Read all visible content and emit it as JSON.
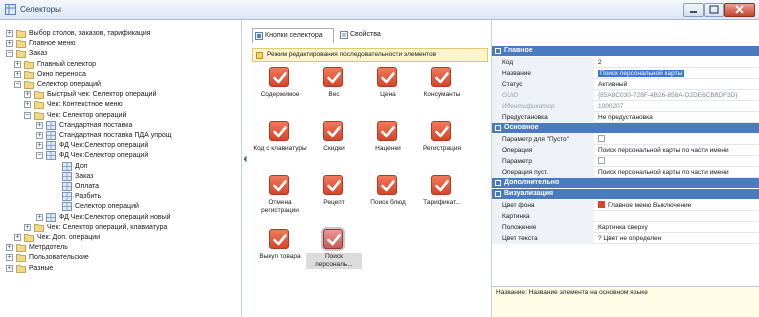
{
  "window": {
    "title": "Селекторы"
  },
  "tree": [
    {
      "label": "Выбор столов, заказов, тарификация",
      "level": 0,
      "exp": "+",
      "icon": "folder"
    },
    {
      "label": "Главное меню",
      "level": 0,
      "exp": "+",
      "icon": "folder"
    },
    {
      "label": "Заказ",
      "level": 0,
      "exp": "−",
      "icon": "folder"
    },
    {
      "label": "Главный селектор",
      "level": 1,
      "exp": "+",
      "icon": "folder"
    },
    {
      "label": "Окно переноса",
      "level": 1,
      "exp": "+",
      "icon": "folder"
    },
    {
      "label": "Селектор операций",
      "level": 1,
      "exp": "−",
      "icon": "folder"
    },
    {
      "label": "Быстрый чек: Селектор операций",
      "level": 2,
      "exp": "+",
      "icon": "folder"
    },
    {
      "label": "Чек: Контекстное меню",
      "level": 2,
      "exp": "+",
      "icon": "folder"
    },
    {
      "label": "Чек: Селектор операций",
      "level": 2,
      "exp": "−",
      "icon": "folder"
    },
    {
      "label": "Стандартная поставка",
      "level": 3,
      "exp": "+",
      "icon": "grid"
    },
    {
      "label": "Стандартная поставка ПДА упрощ",
      "level": 3,
      "exp": "+",
      "icon": "grid"
    },
    {
      "label": "ФД Чек:Селектор операций",
      "level": 3,
      "exp": "+",
      "icon": "grid"
    },
    {
      "label": "ФД Чек:Селектор операций",
      "level": 3,
      "exp": "−",
      "icon": "grid"
    },
    {
      "label": "Доп",
      "level": 4,
      "exp": "",
      "icon": "grid"
    },
    {
      "label": "Заказ",
      "level": 4,
      "exp": "",
      "icon": "grid"
    },
    {
      "label": "Оплата",
      "level": 4,
      "exp": "",
      "icon": "grid"
    },
    {
      "label": "Разбить",
      "level": 4,
      "exp": "",
      "icon": "grid"
    },
    {
      "label": "Селектор операций",
      "level": 4,
      "exp": "",
      "icon": "grid"
    },
    {
      "label": "ФД Чек:Селектор операций новый",
      "level": 3,
      "exp": "+",
      "icon": "grid"
    },
    {
      "label": "Чек: Селектор операций, клавиатура",
      "level": 2,
      "exp": "+",
      "icon": "folder"
    },
    {
      "label": "Чек: Доп. операции",
      "level": 1,
      "exp": "+",
      "icon": "folder"
    },
    {
      "label": "Метрдотель",
      "level": 0,
      "exp": "+",
      "icon": "folder"
    },
    {
      "label": "Пользовательские",
      "level": 0,
      "exp": "+",
      "icon": "folder"
    },
    {
      "label": "Разные",
      "level": 0,
      "exp": "+",
      "icon": "folder"
    }
  ],
  "middle": {
    "tabs": [
      {
        "label": "Кнопки селектора",
        "icon": "buttons-tab-icon"
      },
      {
        "label": "Свойства",
        "icon": "properties-tab-icon"
      }
    ],
    "banner": "Режим редактирования последовательности элементов",
    "items": [
      {
        "label": "Содержимое",
        "selected": false
      },
      {
        "label": "Вес",
        "selected": false
      },
      {
        "label": "Цена",
        "selected": false
      },
      {
        "label": "Консуманты",
        "selected": false
      },
      {
        "label": "Код с клавиатуры",
        "selected": false
      },
      {
        "label": "Скидки",
        "selected": false
      },
      {
        "label": "Наценки",
        "selected": false
      },
      {
        "label": "Регистрация",
        "selected": false
      },
      {
        "label": "Отмена регистрации",
        "selected": false
      },
      {
        "label": "Рецепт",
        "selected": false
      },
      {
        "label": "Поиск блюд",
        "selected": false
      },
      {
        "label": "Тарификат...",
        "selected": false
      },
      {
        "label": "Выкуп товара",
        "selected": false
      },
      {
        "label": "Поиск персональ...",
        "selected": true
      }
    ]
  },
  "props": {
    "sections": [
      {
        "title": "Главное",
        "rows": [
          {
            "key": "Код",
            "value": "2"
          },
          {
            "key": "Название",
            "value": "Поиск персональной карты",
            "highlight": true
          },
          {
            "key": "Статус",
            "value": "Активный"
          },
          {
            "key": "GUID",
            "value": "{85A8C030-728F-4B26-858A-D2DE6CB8DF3D}",
            "dim": true
          },
          {
            "key": "Идентификатор",
            "value": "1000207",
            "dim": true
          },
          {
            "key": "Предустановка",
            "value": "Не предустановка"
          }
        ]
      },
      {
        "title": "Основное",
        "rows": [
          {
            "key": "Параметр для \"Пусто\"",
            "value": "",
            "mini": true
          },
          {
            "key": "Операция",
            "value": "Поиск персональной карты по части имени"
          },
          {
            "key": "Параметр",
            "value": "",
            "mini": true
          },
          {
            "key": "Операция пуст.",
            "value": "Поиск персональной карты по части имени"
          }
        ]
      },
      {
        "title": "Дополнительно",
        "rows": []
      },
      {
        "title": "Визуализация",
        "rows": [
          {
            "key": "Цвет фона",
            "value": "Главное меню Выключение",
            "swatch": true
          },
          {
            "key": "Картинка",
            "value": ""
          },
          {
            "key": "Положение",
            "value": "Картинка сверху"
          },
          {
            "key": "Цвет текста",
            "value": "? Цвет не определен"
          }
        ]
      }
    ],
    "description": "Название: Название элемента на основном языке"
  },
  "colors": {
    "accent": "#4a7abf",
    "check": "#e2482e",
    "banner": "#fdf6cc"
  }
}
